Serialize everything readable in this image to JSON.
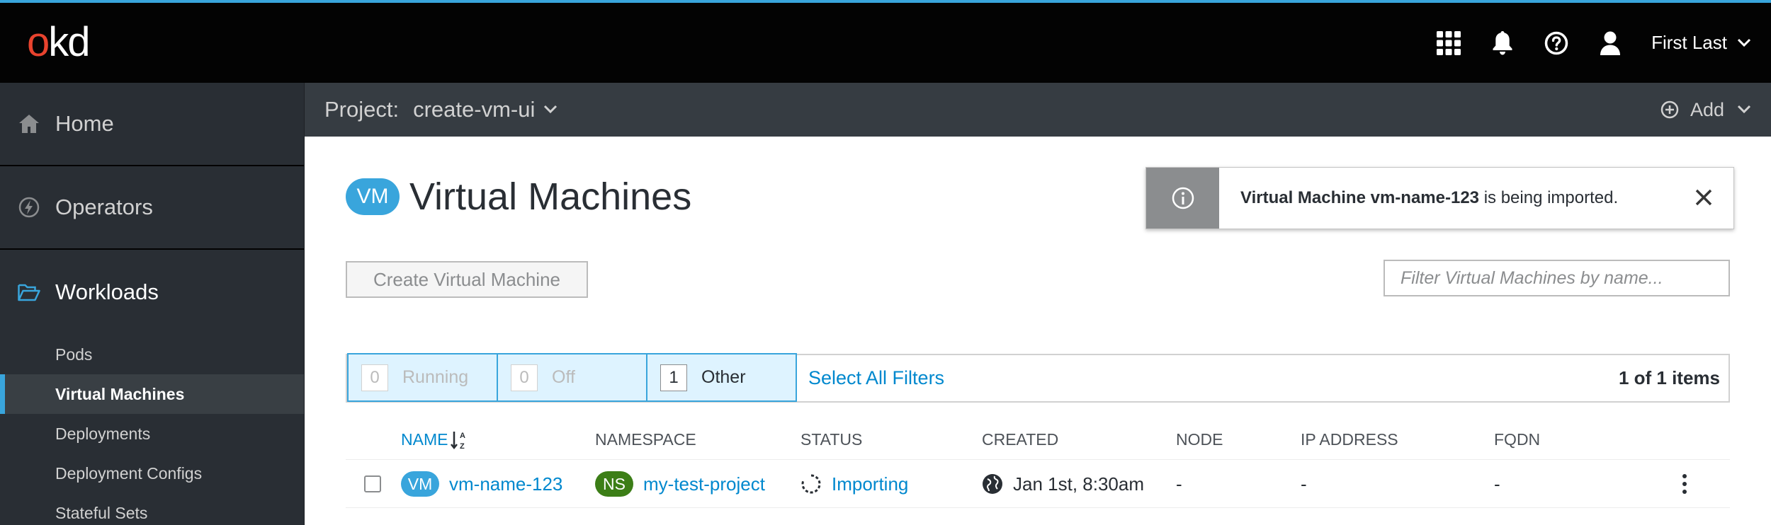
{
  "masthead": {
    "logo_o": "o",
    "logo_kd": "kd",
    "user_name": "First Last",
    "icons": [
      "grid-icon",
      "bell-icon",
      "help-icon",
      "user-icon",
      "chevron-down-icon"
    ]
  },
  "sidebar": {
    "sections": [
      {
        "label": "Home",
        "icon": "home-icon"
      },
      {
        "label": "Operators",
        "icon": "bolt-icon"
      },
      {
        "label": "Workloads",
        "icon": "folder-open-icon"
      }
    ],
    "workloads_items": [
      {
        "label": "Pods"
      },
      {
        "label": "Virtual Machines"
      },
      {
        "label": "Deployments"
      },
      {
        "label": "Deployment Configs"
      },
      {
        "label": "Stateful Sets"
      }
    ]
  },
  "project_bar": {
    "label": "Project:",
    "project_name": "create-vm-ui",
    "add_label": "Add"
  },
  "page": {
    "badge": "VM",
    "title": "Virtual Machines",
    "create_button": "Create Virtual Machine",
    "filter_placeholder": "Filter Virtual Machines by name...",
    "toast": {
      "bold": "Virtual Machine vm-name-123",
      "rest": " is being imported."
    }
  },
  "filters": {
    "items": [
      {
        "count": "0",
        "label": "Running",
        "state": "disabled"
      },
      {
        "count": "0",
        "label": "Off",
        "state": "disabled"
      },
      {
        "count": "1",
        "label": "Other",
        "state": "active"
      }
    ],
    "select_all": "Select All Filters",
    "items_count": "1 of 1 items"
  },
  "table": {
    "headers": {
      "name": "NAME",
      "namespace": "NAMESPACE",
      "status": "STATUS",
      "created": "CREATED",
      "node": "NODE",
      "ip": "IP ADDRESS",
      "fqdn": "FQDN"
    },
    "rows": [
      {
        "name_badge": "VM",
        "name": "vm-name-123",
        "ns_badge": "NS",
        "namespace": "my-test-project",
        "status": "Importing",
        "created": "Jan 1st, 8:30am",
        "node": "-",
        "ip": "-",
        "fqdn": "-"
      }
    ]
  },
  "colors": {
    "accent": "#39a5dc",
    "link": "#0088ce",
    "namespace_badge": "#3c7e17",
    "logo_o": "#e8432e"
  }
}
